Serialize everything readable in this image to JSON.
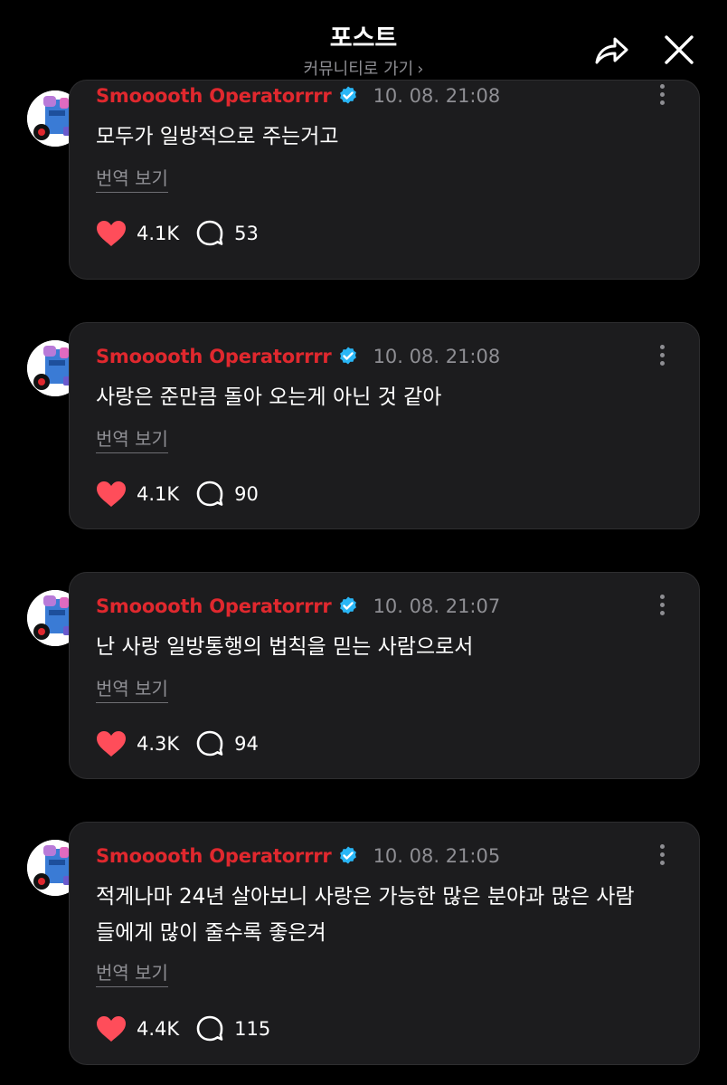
{
  "header": {
    "title": "포스트",
    "community_link": "커뮤니티로 가기",
    "share_icon": "share-arrow-icon",
    "close_icon": "close-icon"
  },
  "colors": {
    "background": "#000000",
    "card": "#1c1c1e",
    "author": "#e0282e",
    "verified": "#29b6f6",
    "like": "#ff4d5a",
    "muted": "#8e8e93"
  },
  "posts": [
    {
      "author": "Smooooth Operatorrrr",
      "time": "10. 08. 21:08",
      "text": "모두가 일방적으로 주는거고",
      "translate": "번역 보기",
      "likes": "4.1K",
      "replies": "53"
    },
    {
      "author": "Smooooth Operatorrrr",
      "time": "10. 08. 21:08",
      "text": "사랑은 준만큼 돌아 오는게 아닌 것 같아",
      "translate": "번역 보기",
      "likes": "4.1K",
      "replies": "90"
    },
    {
      "author": "Smooooth Operatorrrr",
      "time": "10. 08. 21:07",
      "text": "난 사랑 일방통행의 법칙을 믿는 사람으로서",
      "translate": "번역 보기",
      "likes": "4.3K",
      "replies": "94"
    },
    {
      "author": "Smooooth Operatorrrr",
      "time": "10. 08. 21:05",
      "text": "적게나마 24년 살아보니 사랑은 가능한 많은 분야과 많은 사람들에게 많이 줄수록 좋은겨",
      "translate": "번역 보기",
      "likes": "4.4K",
      "replies": "115"
    }
  ]
}
